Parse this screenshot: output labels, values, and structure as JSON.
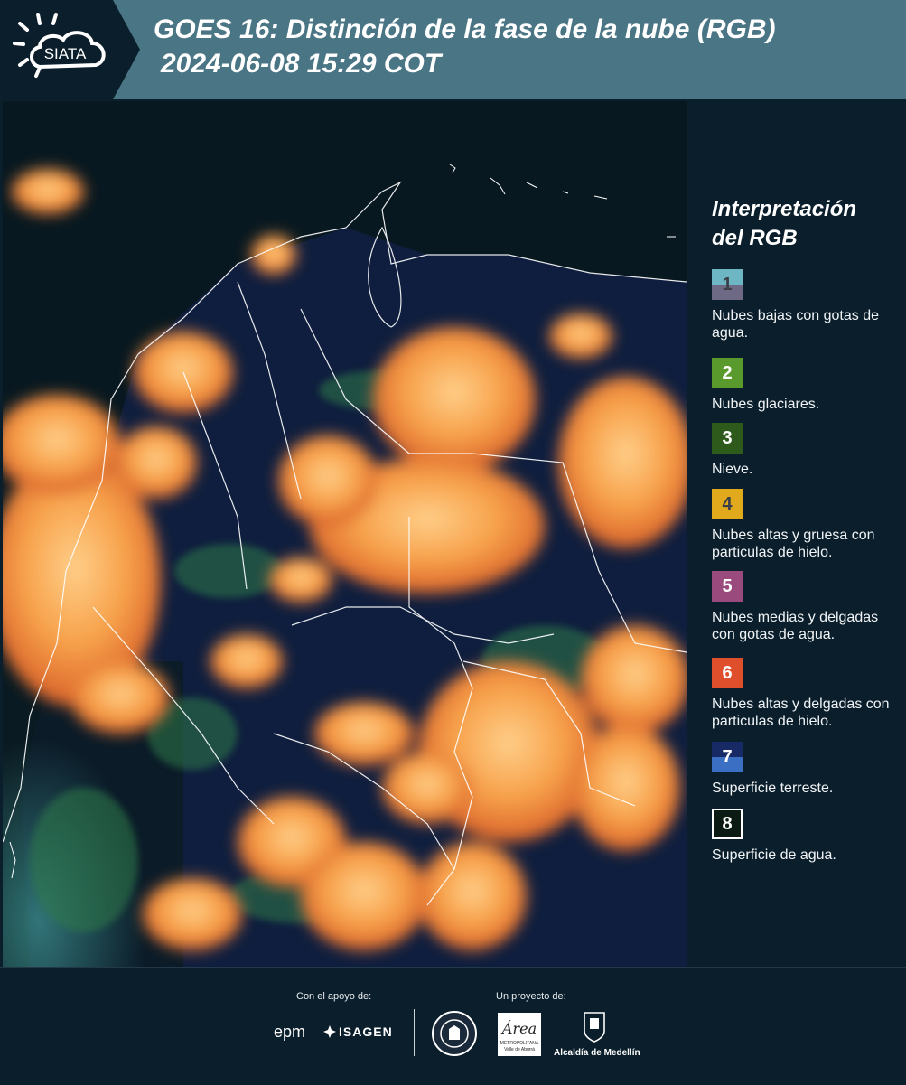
{
  "header": {
    "brand": "SIATA",
    "title_line1": "GOES 16: Distinción de la fase de la nube (RGB)",
    "title_line2": "2024-06-08 15:29 COT"
  },
  "legend": {
    "title_line1": "Interpretación",
    "title_line2": "del RGB",
    "items": [
      {
        "number": "1",
        "label": "Nubes bajas con gotas de agua.",
        "color_top": "#6fb6c4",
        "color_bottom": "#6e6a86"
      },
      {
        "number": "2",
        "label": "Nubes glaciares.",
        "color_top": "#5a9a2c",
        "color_bottom": "#5a9a2c"
      },
      {
        "number": "3",
        "label": "Nieve.",
        "color_top": "#2e5a1c",
        "color_bottom": "#2e5a1c"
      },
      {
        "number": "4",
        "label": "Nubes altas y gruesa con particulas de hielo.",
        "color_top": "#e1aa1c",
        "color_bottom": "#e1aa1c"
      },
      {
        "number": "5",
        "label": "Nubes medias y delgadas con gotas de agua.",
        "color_top": "#9b4a7e",
        "color_bottom": "#9b4a7e"
      },
      {
        "number": "6",
        "label": "Nubes altas y delgadas con particulas de hielo.",
        "color_top": "#df4f2c",
        "color_bottom": "#df4f2c"
      },
      {
        "number": "7",
        "label": "Superficie terreste.",
        "color_top": "#172a66",
        "color_bottom": "#3a6fc4"
      },
      {
        "number": "8",
        "label": "Superficie de agua.",
        "color_top": "#0b1a12",
        "color_bottom": "#0b1a12"
      }
    ]
  },
  "footer": {
    "support_label": "Con el apoyo de:",
    "project_label": "Un proyecto de:",
    "sponsor1": "epm",
    "sponsor2": "ISAGEN",
    "area_name": "Área",
    "area_sub": "METROPOLITANA",
    "area_sub2": "Valle de Aburrá",
    "alcaldia": "Alcaldía de Medellín"
  },
  "colors": {
    "header_bg": "#4a7584",
    "page_bg": "#0b1e2b",
    "cloud_orange": "#f6a04a"
  }
}
